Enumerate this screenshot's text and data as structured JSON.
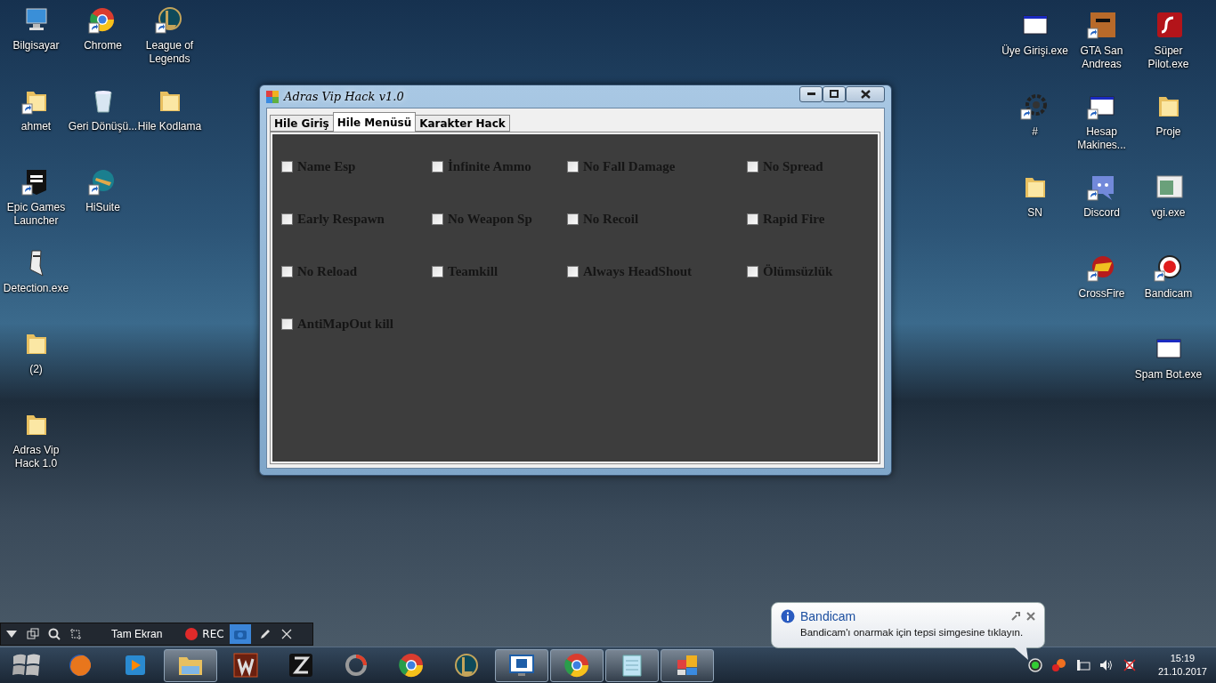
{
  "desktop_left": [
    [
      {
        "label": "Bilgisayar",
        "kind": "computer",
        "shortcut": false
      },
      {
        "label": "ahmet",
        "kind": "userfolder",
        "shortcut": true
      },
      {
        "label": "Epic Games Launcher",
        "kind": "epic",
        "shortcut": true
      },
      {
        "label": "Detection.exe",
        "kind": "detection",
        "shortcut": false
      },
      {
        "label": "(2)",
        "kind": "folder",
        "shortcut": false
      },
      {
        "label": "Adras Vip Hack 1.0",
        "kind": "folder",
        "shortcut": false
      }
    ],
    [
      {
        "label": "Chrome",
        "kind": "chrome",
        "shortcut": true
      },
      {
        "label": "Geri Dönüşü...",
        "kind": "recycle",
        "shortcut": false
      },
      {
        "label": "HiSuite",
        "kind": "hisuite",
        "shortcut": true
      }
    ],
    [
      {
        "label": "League of Legends",
        "kind": "lol",
        "shortcut": true
      },
      {
        "label": "Hile Kodlama",
        "kind": "folder",
        "shortcut": false
      }
    ]
  ],
  "desktop_right": [
    [
      {
        "label": "Üye Girişi.exe",
        "kind": "exe",
        "shortcut": false
      },
      {
        "label": "#",
        "kind": "gear",
        "shortcut": true
      },
      {
        "label": "SN",
        "kind": "folder",
        "shortcut": false
      }
    ],
    [
      {
        "label": "GTA San Andreas",
        "kind": "gta",
        "shortcut": true
      },
      {
        "label": "Hesap Makines...",
        "kind": "exe",
        "shortcut": true
      },
      {
        "label": "Discord",
        "kind": "discord",
        "shortcut": true
      },
      {
        "label": "CrossFire",
        "kind": "crossfire",
        "shortcut": true
      }
    ],
    [
      {
        "label": "Süper Pilot.exe",
        "kind": "flash",
        "shortcut": false
      },
      {
        "label": "Proje",
        "kind": "folder",
        "shortcut": false
      },
      {
        "label": "vgi.exe",
        "kind": "vgi",
        "shortcut": false
      },
      {
        "label": "Bandicam",
        "kind": "bandicam",
        "shortcut": true
      },
      {
        "label": "Spam Bot.exe",
        "kind": "exe",
        "shortcut": false
      }
    ]
  ],
  "window": {
    "title": "Adras Vip Hack v1.0",
    "tabs": [
      {
        "label": "Hile Giriş",
        "selected": false
      },
      {
        "label": "Hile Menüsü",
        "selected": true
      },
      {
        "label": "Karakter Hack",
        "selected": false
      }
    ],
    "checkbox_rows": [
      [
        {
          "label": "Name Esp",
          "checked": false
        },
        {
          "label": "İnfinite Ammo",
          "checked": false
        },
        {
          "label": "No Fall Damage",
          "checked": false
        },
        {
          "label": "No Spread",
          "checked": false
        }
      ],
      [
        {
          "label": "Early Respawn",
          "checked": false
        },
        {
          "label": "No Weapon Sp",
          "checked": false
        },
        {
          "label": "No Recoil",
          "checked": false
        },
        {
          "label": "Rapid Fire",
          "checked": false
        }
      ],
      [
        {
          "label": "No Reload",
          "checked": false
        },
        {
          "label": "Teamkill",
          "checked": false
        },
        {
          "label": "Always HeadShout",
          "checked": false
        },
        {
          "label": "Ölümsüzlük",
          "checked": false
        }
      ],
      [
        {
          "label": "AntiMapOut kill",
          "checked": false
        }
      ]
    ]
  },
  "recorder_bar": {
    "mode": "Tam Ekran",
    "rec": "REC"
  },
  "notification": {
    "title": "Bandicam",
    "message": "Bandicam'ı onarmak için tepsi simgesine tıklayın."
  },
  "taskbar": {
    "items": [
      {
        "kind": "firefox",
        "running": false
      },
      {
        "kind": "media",
        "running": false
      },
      {
        "kind": "explorer",
        "running": true
      },
      {
        "kind": "wolfteam",
        "running": false
      },
      {
        "kind": "zapp",
        "running": false
      },
      {
        "kind": "ring",
        "running": false
      },
      {
        "kind": "chrome",
        "running": false
      },
      {
        "kind": "lol",
        "running": false
      },
      {
        "kind": "vb",
        "running": true
      },
      {
        "kind": "chrome",
        "running": true
      },
      {
        "kind": "notepad",
        "running": true
      },
      {
        "kind": "control",
        "running": true
      }
    ],
    "time": "15:19",
    "date": "21.10.2017"
  }
}
